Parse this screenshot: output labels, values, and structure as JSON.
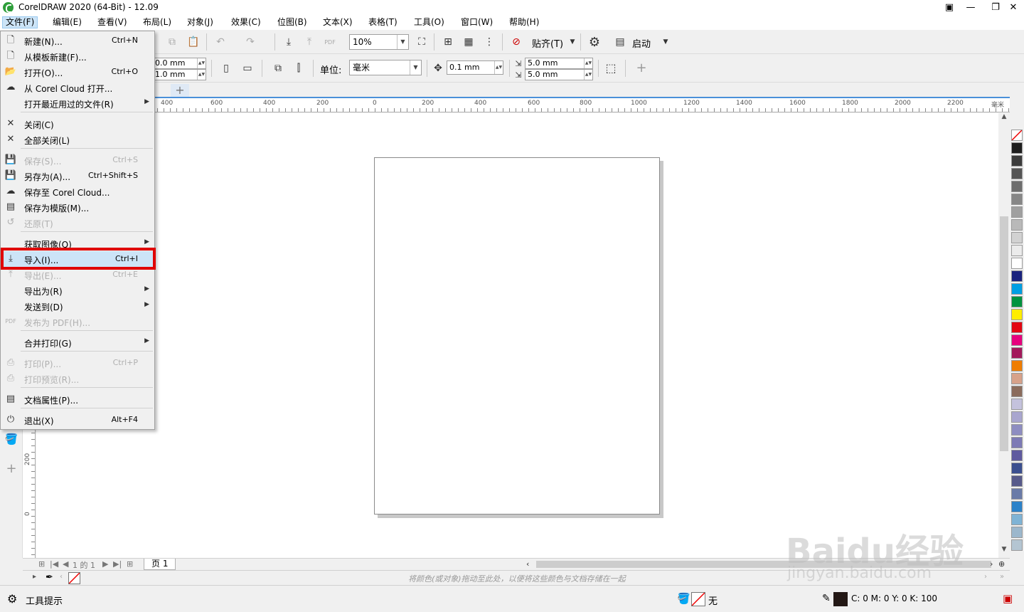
{
  "window": {
    "title": "CorelDRAW 2020 (64-Bit) - 12.09",
    "controls": [
      "minimize",
      "restore",
      "close"
    ]
  },
  "menubar": {
    "items": [
      {
        "label": "文件(F)"
      },
      {
        "label": "编辑(E)"
      },
      {
        "label": "查看(V)"
      },
      {
        "label": "布局(L)"
      },
      {
        "label": "对象(J)"
      },
      {
        "label": "效果(C)"
      },
      {
        "label": "位图(B)"
      },
      {
        "label": "文本(X)"
      },
      {
        "label": "表格(T)"
      },
      {
        "label": "工具(O)"
      },
      {
        "label": "窗口(W)"
      },
      {
        "label": "帮助(H)"
      }
    ]
  },
  "toolbar1": {
    "zoom": "10%",
    "snap_label": "贴齐(T)",
    "launch_label": "启动"
  },
  "toolbar2": {
    "width": "0.0 mm",
    "height": "1.0 mm",
    "unit_label": "单位:",
    "unit_value": "毫米",
    "nudge": "0.1 mm",
    "dup_x": "5.0 mm",
    "dup_y": "5.0 mm"
  },
  "ruler": {
    "h_labels": [
      "400",
      "600",
      "400",
      "200",
      "0",
      "200",
      "400",
      "600",
      "800",
      "1000",
      "1200",
      "1400",
      "1600",
      "1800",
      "2000",
      "2200",
      "毫米"
    ],
    "v_labels": [
      "200",
      "0"
    ]
  },
  "file_menu": {
    "items": [
      {
        "label": "新建(N)...",
        "shortcut": "Ctrl+N",
        "icon": "new-doc-icon",
        "glyph": "🗋",
        "disabled": false,
        "submenu": false
      },
      {
        "label": "从模板新建(F)...",
        "shortcut": "",
        "icon": "new-from-template-icon",
        "glyph": "🗋",
        "disabled": false,
        "submenu": false
      },
      {
        "label": "打开(O)...",
        "shortcut": "Ctrl+O",
        "icon": "open-folder-icon",
        "glyph": "📂",
        "disabled": false,
        "submenu": false
      },
      {
        "label": "从 Corel Cloud 打开...",
        "shortcut": "",
        "icon": "cloud-open-icon",
        "glyph": "☁",
        "disabled": false,
        "submenu": false
      },
      {
        "label": "打开最近用过的文件(R)",
        "shortcut": "",
        "icon": "",
        "glyph": "",
        "disabled": false,
        "submenu": true
      },
      {
        "label": "关闭(C)",
        "shortcut": "",
        "icon": "close-doc-icon",
        "glyph": "✕",
        "disabled": false,
        "submenu": false
      },
      {
        "label": "全部关闭(L)",
        "shortcut": "",
        "icon": "close-all-icon",
        "glyph": "✕",
        "disabled": false,
        "submenu": false
      },
      {
        "label": "保存(S)...",
        "shortcut": "Ctrl+S",
        "icon": "save-icon",
        "glyph": "💾",
        "disabled": true,
        "submenu": false
      },
      {
        "label": "另存为(A)...",
        "shortcut": "Ctrl+Shift+S",
        "icon": "save-as-icon",
        "glyph": "💾",
        "disabled": false,
        "submenu": false
      },
      {
        "label": "保存至 Corel Cloud...",
        "shortcut": "",
        "icon": "cloud-save-icon",
        "glyph": "☁",
        "disabled": false,
        "submenu": false
      },
      {
        "label": "保存为模版(M)...",
        "shortcut": "",
        "icon": "save-template-icon",
        "glyph": "▤",
        "disabled": false,
        "submenu": false
      },
      {
        "label": "还原(T)",
        "shortcut": "",
        "icon": "revert-icon",
        "glyph": "↺",
        "disabled": true,
        "submenu": false
      },
      {
        "label": "获取图像(Q)",
        "shortcut": "",
        "icon": "",
        "glyph": "",
        "disabled": false,
        "submenu": true
      },
      {
        "label": "导入(I)...",
        "shortcut": "Ctrl+I",
        "icon": "import-icon",
        "glyph": "⤓",
        "disabled": false,
        "submenu": false
      },
      {
        "label": "导出(E)...",
        "shortcut": "Ctrl+E",
        "icon": "export-icon",
        "glyph": "⤒",
        "disabled": true,
        "submenu": false
      },
      {
        "label": "导出为(R)",
        "shortcut": "",
        "icon": "",
        "glyph": "",
        "disabled": false,
        "submenu": true
      },
      {
        "label": "发送到(D)",
        "shortcut": "",
        "icon": "",
        "glyph": "",
        "disabled": false,
        "submenu": true
      },
      {
        "label": "发布为 PDF(H)...",
        "shortcut": "",
        "icon": "pdf-icon",
        "glyph": "PDF",
        "disabled": true,
        "submenu": false
      },
      {
        "label": "合并打印(G)",
        "shortcut": "",
        "icon": "",
        "glyph": "",
        "disabled": false,
        "submenu": true
      },
      {
        "label": "打印(P)...",
        "shortcut": "Ctrl+P",
        "icon": "print-icon",
        "glyph": "⎙",
        "disabled": true,
        "submenu": false
      },
      {
        "label": "打印预览(R)...",
        "shortcut": "",
        "icon": "print-preview-icon",
        "glyph": "⎙",
        "disabled": true,
        "submenu": false
      },
      {
        "label": "文档属性(P)...",
        "shortcut": "",
        "icon": "doc-properties-icon",
        "glyph": "▤",
        "disabled": false,
        "submenu": false
      },
      {
        "label": "退出(X)",
        "shortcut": "Alt+F4",
        "icon": "power-icon",
        "glyph": "⏻",
        "disabled": false,
        "submenu": false
      }
    ],
    "highlighted_label": "导入(I)..."
  },
  "pagebar": {
    "page_info": "1 的 1",
    "page_tab": "页 1"
  },
  "doc_palette_hint": "将颜色(或对象)拖动至此处，以便将这些颜色与文档存储在一起",
  "status": {
    "tool_hint": "工具提示",
    "fill_value": "无",
    "outline_cmyk": "C: 0 M: 0 Y: 0 K: 100"
  },
  "palette_colors": [
    "#1e1e1e",
    "#3c3c3c",
    "#555555",
    "#6e6e6e",
    "#878787",
    "#a0a0a0",
    "#b9b9b9",
    "#d2d2d2",
    "#ebebeb",
    "#ffffff",
    "#1a237e",
    "#009fe3",
    "#00923f",
    "#ffed00",
    "#e30613",
    "#e6007e",
    "#a3195b",
    "#ef7d00",
    "#d7a28a",
    "#8b6c5c",
    "#c4c2dd",
    "#a9a6cf",
    "#8e8dc1",
    "#7d7ab5",
    "#5f5a9f",
    "#3b4f8f",
    "#575a8a",
    "#6a7ba8",
    "#2c82c9",
    "#7fb3d5",
    "#9cb7cc",
    "#b4c5d2"
  ],
  "watermark": {
    "text_big": "Baidu经验",
    "text_small": "jingyan.baidu.com"
  }
}
